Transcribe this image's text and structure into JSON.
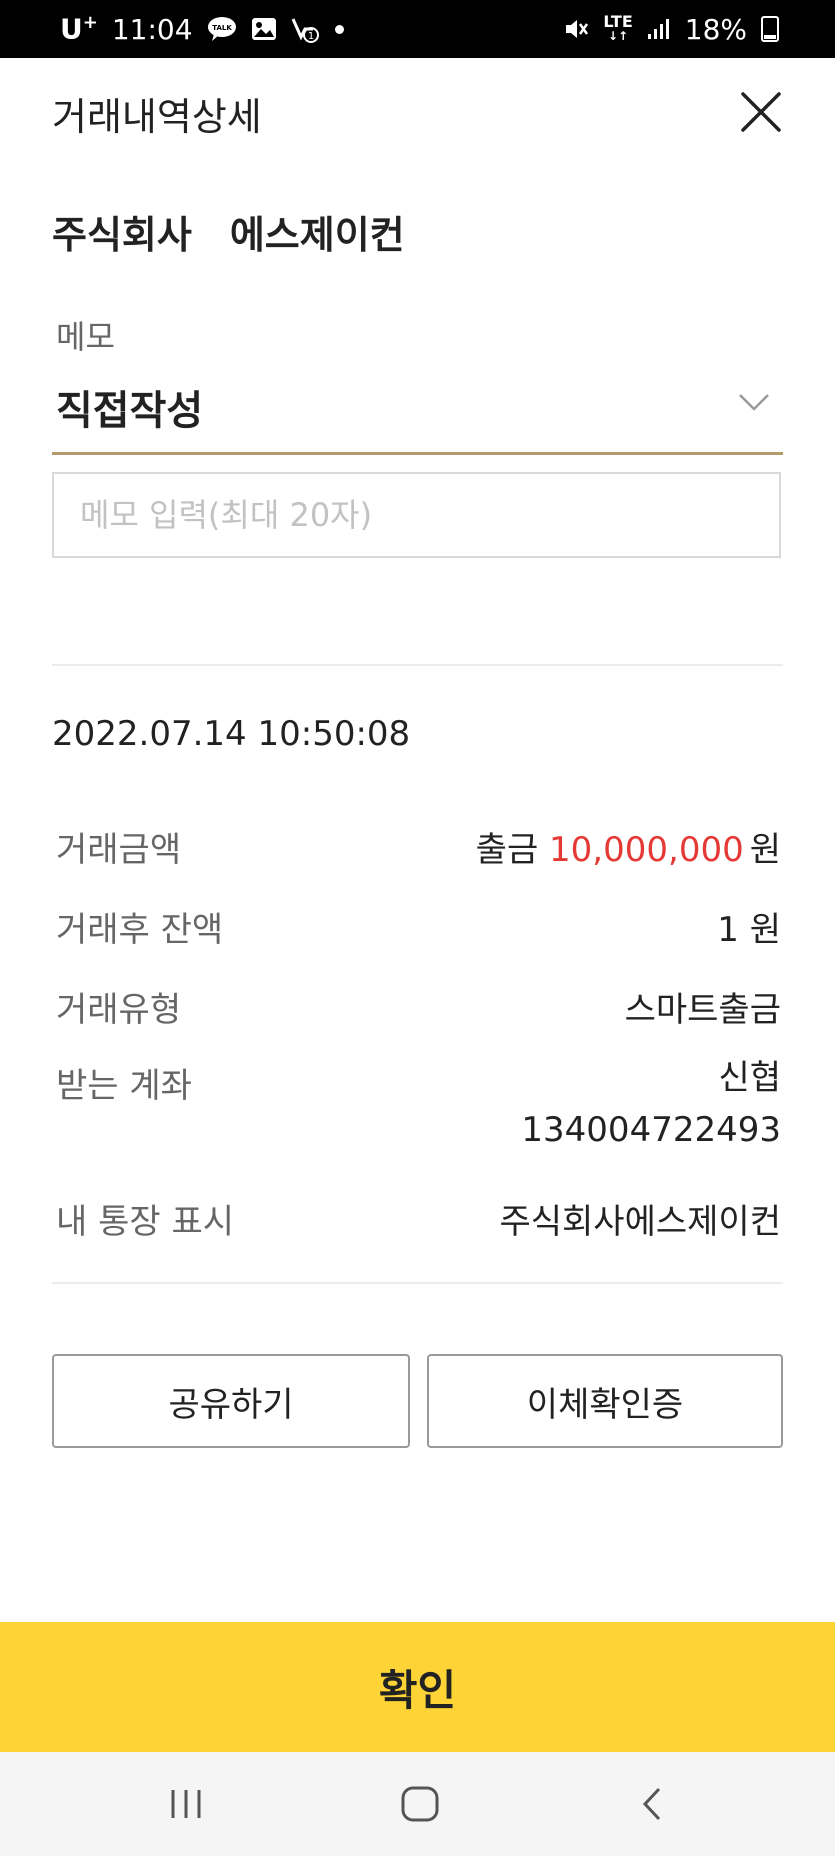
{
  "status_bar": {
    "carrier": "U",
    "carrier_sup": "+",
    "time": "11:04",
    "network": "LTE",
    "battery": "18%",
    "icons": [
      "talk-icon",
      "gallery-icon",
      "mute-icon",
      "signal-icon",
      "battery-icon"
    ]
  },
  "header": {
    "title": "거래내역상세",
    "close_icon": "close-icon"
  },
  "company_name": "주식회사　에스제이컨",
  "memo": {
    "label": "메모",
    "selected": "직접작성",
    "placeholder": "메모 입력(최대 20자)"
  },
  "transaction": {
    "datetime": "2022.07.14 10:50:08",
    "rows": [
      {
        "label": "거래금액",
        "prefix": "출금 ",
        "amount": "10,000,000",
        "suffix": "원"
      },
      {
        "label": "거래후 잔액",
        "value": "1 원"
      },
      {
        "label": "거래유형",
        "value": "스마트출금"
      },
      {
        "label": "받는 계좌",
        "value_line1": "신협",
        "value_line2": "134004722493"
      },
      {
        "label": "내 통장 표시",
        "value": "주식회사에스제이컨"
      }
    ]
  },
  "buttons": {
    "share": "공유하기",
    "transfer_certificate": "이체확인증",
    "confirm": "확인"
  },
  "colors": {
    "accent_yellow": "#fdd335",
    "memo_underline": "#b39b6b",
    "amount_red": "#e53935"
  }
}
